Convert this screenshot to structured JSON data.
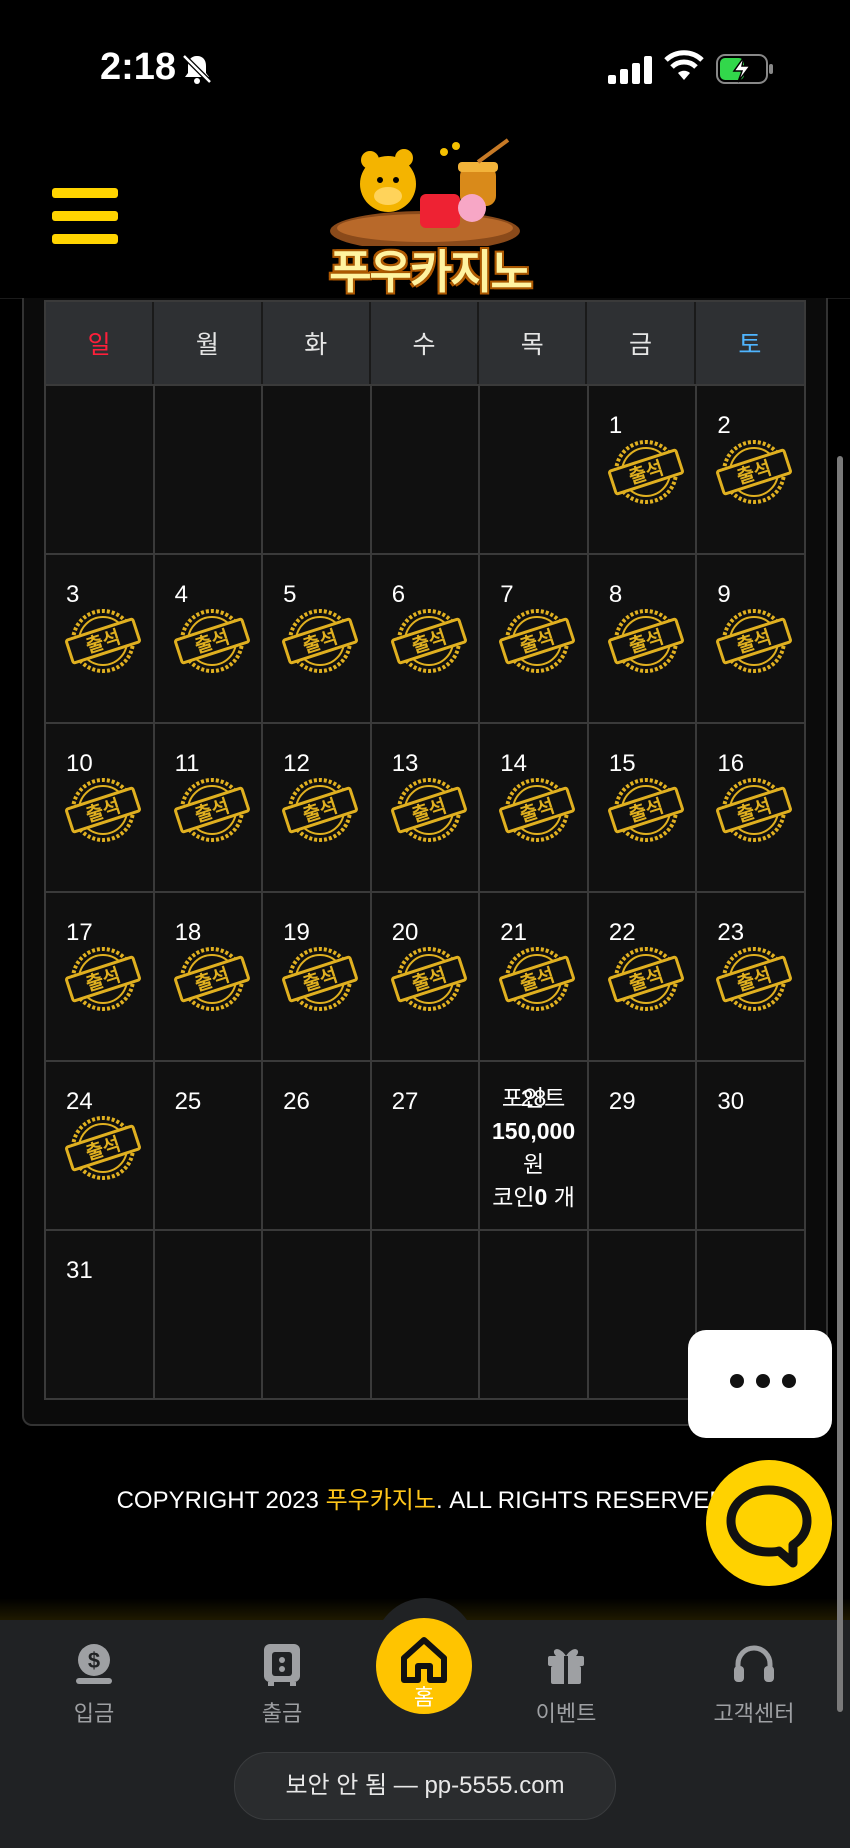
{
  "status_bar": {
    "time": "2:18"
  },
  "header": {
    "logo_text": "푸우카지노"
  },
  "calendar": {
    "weekdays": [
      {
        "label": "일"
      },
      {
        "label": "월"
      },
      {
        "label": "화"
      },
      {
        "label": "수"
      },
      {
        "label": "목"
      },
      {
        "label": "금"
      },
      {
        "label": "토"
      }
    ],
    "stamp_text": "출석",
    "cells": [
      {
        "day": ""
      },
      {
        "day": ""
      },
      {
        "day": ""
      },
      {
        "day": ""
      },
      {
        "day": ""
      },
      {
        "day": "1",
        "stamp": true
      },
      {
        "day": "2",
        "stamp": true
      },
      {
        "day": "3",
        "stamp": true
      },
      {
        "day": "4",
        "stamp": true
      },
      {
        "day": "5",
        "stamp": true
      },
      {
        "day": "6",
        "stamp": true
      },
      {
        "day": "7",
        "stamp": true
      },
      {
        "day": "8",
        "stamp": true
      },
      {
        "day": "9",
        "stamp": true
      },
      {
        "day": "10",
        "stamp": true
      },
      {
        "day": "11",
        "stamp": true
      },
      {
        "day": "12",
        "stamp": true
      },
      {
        "day": "13",
        "stamp": true
      },
      {
        "day": "14",
        "stamp": true
      },
      {
        "day": "15",
        "stamp": true
      },
      {
        "day": "16",
        "stamp": true
      },
      {
        "day": "17",
        "stamp": true
      },
      {
        "day": "18",
        "stamp": true
      },
      {
        "day": "19",
        "stamp": true
      },
      {
        "day": "20",
        "stamp": true
      },
      {
        "day": "21",
        "stamp": true
      },
      {
        "day": "22",
        "stamp": true
      },
      {
        "day": "23",
        "stamp": true
      },
      {
        "day": "24",
        "stamp": true
      },
      {
        "day": "25"
      },
      {
        "day": "26"
      },
      {
        "day": "27"
      },
      {
        "day": "28",
        "today": true,
        "point_label": "포인트",
        "point_value": "150,000",
        "point_unit": "원",
        "coin_label": "코인",
        "coin_value": "0",
        "coin_unit": "개"
      },
      {
        "day": "29"
      },
      {
        "day": "30"
      },
      {
        "day": "31"
      },
      {
        "day": ""
      },
      {
        "day": ""
      },
      {
        "day": ""
      },
      {
        "day": ""
      },
      {
        "day": ""
      },
      {
        "day": ""
      }
    ]
  },
  "footer": {
    "copyright_prefix": "COPYRIGHT 2023 ",
    "brand": "푸우카지노",
    "copyright_suffix": ". ALL RIGHTS RESERVED."
  },
  "bottom_nav": {
    "deposit": "입금",
    "withdraw": "출금",
    "home": "홈",
    "event": "이벤트",
    "support": "고객센터"
  },
  "url_bar": {
    "text": "보안 안 됨 — pp-5555.com"
  },
  "colors": {
    "accent": "#ffc400",
    "sunday": "#ff1f3a",
    "saturday": "#4fb5ff",
    "stamp": "#e0b020"
  }
}
